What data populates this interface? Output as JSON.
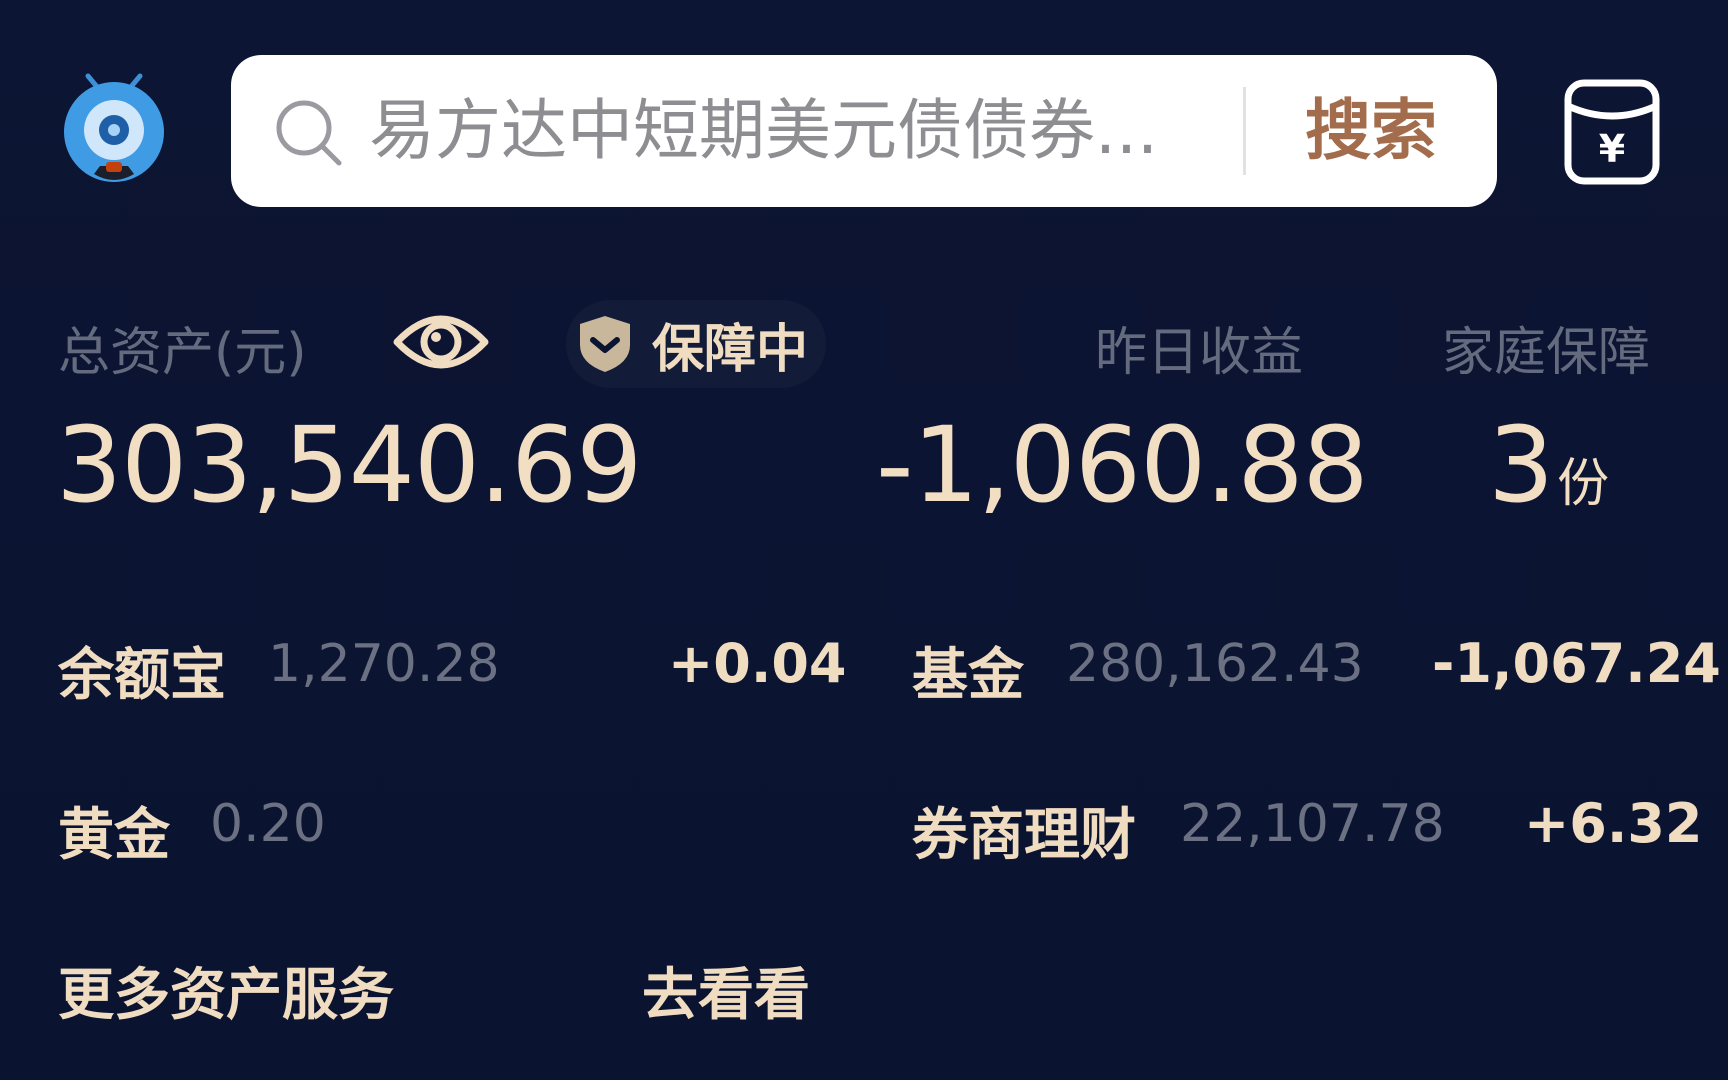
{
  "header": {
    "search_placeholder": "易方达中短期美元债债券...",
    "search_button": "搜索"
  },
  "summary": {
    "total_assets_label": "总资产(元)",
    "total_assets_value": "303,540.69",
    "protect_label": "保障中",
    "yesterday_label": "昨日收益",
    "yesterday_value": "-1,060.88",
    "family_label": "家庭保障",
    "family_value": "3",
    "family_unit": "份"
  },
  "assets": {
    "yuebao": {
      "name": "余额宝",
      "amount": "1,270.28",
      "change": "+0.04"
    },
    "fund": {
      "name": "基金",
      "amount": "280,162.43",
      "change": "-1,067.24"
    },
    "gold": {
      "name": "黄金",
      "amount": "0.20"
    },
    "broker": {
      "name": "券商理财",
      "amount": "22,107.78",
      "change": "+6.32"
    }
  },
  "more": {
    "label": "更多资产服务",
    "link": "去看看"
  },
  "colors": {
    "background": "#0b1431",
    "gold_text": "#f0dcc0",
    "muted_text": "#646b7e",
    "search_button": "#a36d4d"
  }
}
